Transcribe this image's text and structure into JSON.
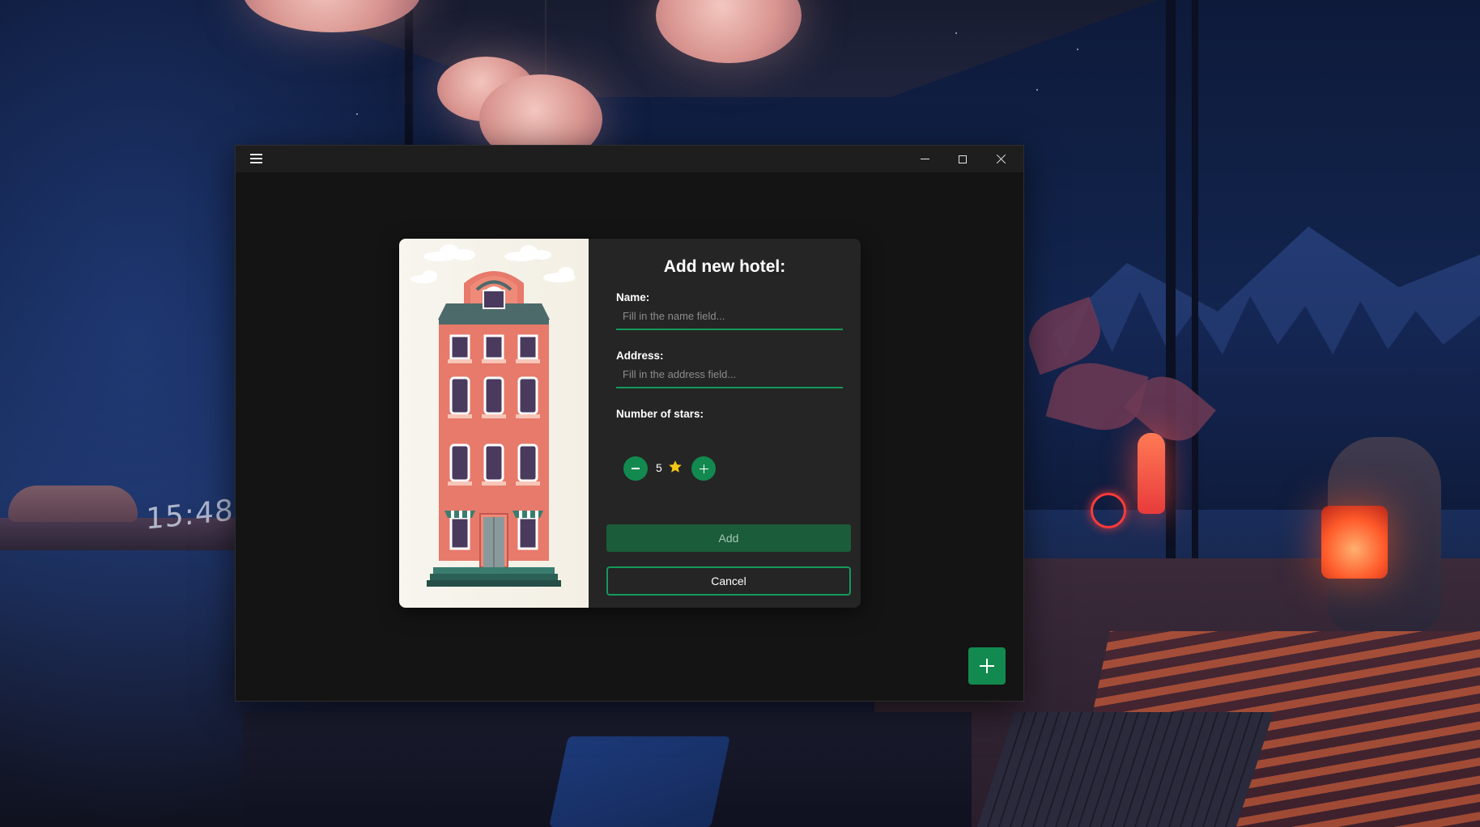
{
  "desktop": {
    "clock": "15:48"
  },
  "window": {
    "icons": {
      "menu": "hamburger-icon",
      "minimize": "minimize-icon",
      "maximize": "maximize-icon",
      "close": "close-icon"
    }
  },
  "dialog": {
    "title": "Add new hotel:",
    "illustration": "hotel-building-illustration",
    "name": {
      "label": "Name:",
      "value": "",
      "placeholder": "Fill in the name field..."
    },
    "address": {
      "label": "Address:",
      "value": "",
      "placeholder": "Fill in the address field..."
    },
    "stars": {
      "label": "Number of stars:",
      "value": "5",
      "icon": "star-icon",
      "decrement_icon": "minus-icon",
      "increment_icon": "plus-icon"
    },
    "add_label": "Add",
    "cancel_label": "Cancel"
  },
  "fab": {
    "icon": "plus-icon"
  },
  "colors": {
    "accent": "#128a4f",
    "accent_border": "#14995a",
    "add_button_bg": "#1b5c3a",
    "dialog_bg": "#252525",
    "window_bg": "#141414",
    "titlebar_bg": "#1e1e1e",
    "star": "#f5c518"
  }
}
